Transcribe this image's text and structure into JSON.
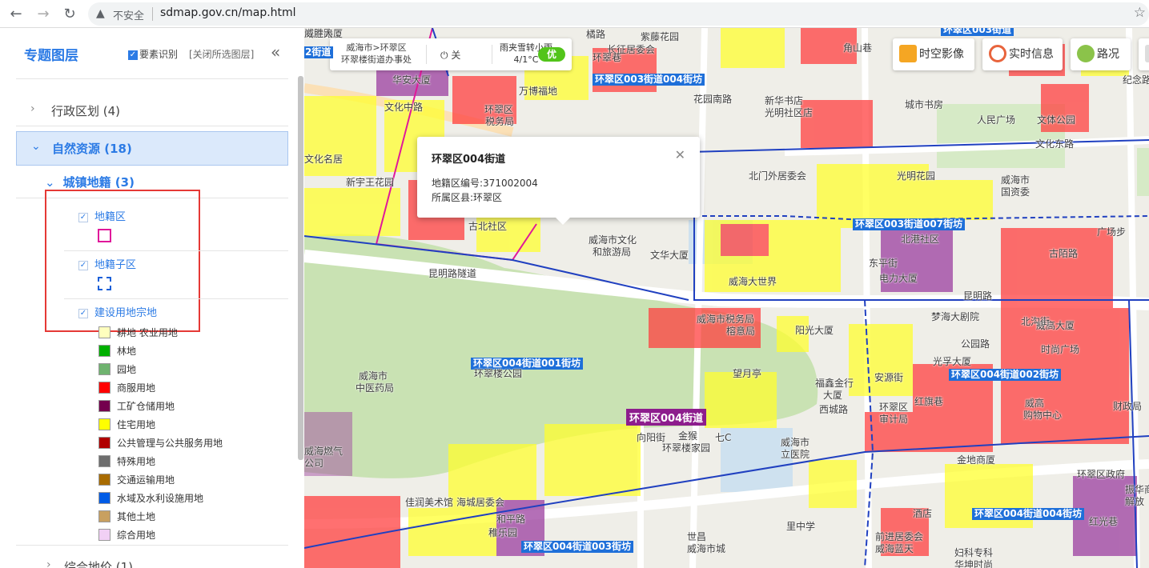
{
  "browser": {
    "security_label": "不安全",
    "url": "sdmap.gov.cn/map.html"
  },
  "panel": {
    "title": "专题图层",
    "feature_toggle": "要素识别",
    "close_selected": "[关闭所选图层]",
    "categories": [
      {
        "label": "行政区划 (4)"
      },
      {
        "label": "自然资源 (18)"
      },
      {
        "label": "综合地价 (1)"
      }
    ],
    "subcategory": "城镇地籍 (3)",
    "layers": [
      {
        "label": "地籍区"
      },
      {
        "label": "地籍子区"
      },
      {
        "label": "建设用地宗地"
      }
    ],
    "legend": [
      {
        "label": "耕地 农业用地",
        "color": "#ffffbe"
      },
      {
        "label": "林地",
        "color": "#00b000"
      },
      {
        "label": "园地",
        "color": "#6fb36f"
      },
      {
        "label": "商服用地",
        "color": "#ff0000"
      },
      {
        "label": "工矿仓储用地",
        "color": "#74004e"
      },
      {
        "label": "住宅用地",
        "color": "#ffff00"
      },
      {
        "label": "公共管理与公共服务用地",
        "color": "#b00000"
      },
      {
        "label": "特殊用地",
        "color": "#6e6e6e"
      },
      {
        "label": "交通运输用地",
        "color": "#a86b00"
      },
      {
        "label": "水域及水利设施用地",
        "color": "#005ce6"
      },
      {
        "label": "其他土地",
        "color": "#c8a060"
      },
      {
        "label": "综合用地",
        "color": "#f1d0f5"
      }
    ]
  },
  "map": {
    "info_bar": {
      "location_line1": "威海市>环翠区",
      "location_line2": "环翠楼街道办事处",
      "power_label": "关",
      "weather_line1": "雨夹雪转小雨",
      "weather_line2": "4/1°C",
      "aqi": "优"
    },
    "tools": [
      {
        "label": "时空影像",
        "icon": "layers-icon"
      },
      {
        "label": "实时信息",
        "icon": "clock-icon"
      },
      {
        "label": "路况",
        "icon": "traffic-icon"
      }
    ],
    "popup": {
      "title": "环翠区004街道",
      "code_label": "地籍区编号:371002004",
      "county_label": "所属区县:环翠区"
    },
    "street_tags": [
      "环翠区003街道004街坊",
      "环翠区003街道007街坊",
      "环翠区004街道001街坊",
      "环翠区004街道002街坊",
      "环翠区004街道003街坊",
      "环翠区004街道004街坊",
      "环翠区003街道",
      "2街道"
    ],
    "district_tag": "环翠区004街道",
    "labels": [
      "橘路",
      "紫藤花园",
      "长征居委会",
      "角山巷",
      "华安大厦",
      "万博福地",
      "文化中路",
      "环翠区",
      "税务局",
      "花园南路",
      "新华书店",
      "光明社区店",
      "城市书房",
      "人民广场",
      "文体公园",
      "纪念路",
      "文化东路",
      "文化名居",
      "新宇王花园",
      "北门外居委会",
      "光明花园",
      "威海市",
      "国资委",
      "古北社区",
      "威海市文化",
      "和旅游局",
      "文华大厦",
      "北港社区",
      "东平街",
      "电力大厦",
      "威海大世界",
      "昆明路隧道",
      "昆明路",
      "威海市税务局",
      "榕意局",
      "阳光大厦",
      "梦海大剧院",
      "光孚大厦",
      "公园路",
      "威高大厦",
      "时尚广场",
      "威海市",
      "中医药局",
      "环翠楼公园",
      "望月亭",
      "福鑫金行",
      "大厦",
      "安源街",
      "环翠区",
      "审计局",
      "威高",
      "购物中心",
      "财政局",
      "金猴",
      "环翠楼家园",
      "威海市",
      "立医院",
      "金地商厦",
      "环翠区政府",
      "威海燃气",
      "公司",
      "海城居委会",
      "佳润美术馆",
      "和平路",
      "稚乐园",
      "世昌",
      "威海市城",
      "里中学",
      "前进居委会",
      "威海蓝天",
      "妇科专科",
      "华坤时尚",
      "酒店",
      "红光巷",
      "振华商厦",
      "解放",
      "七C",
      "西城路",
      "红旗巷",
      "向阳街",
      "环翠巷",
      "北沟街",
      "古陌路",
      "广场步",
      "海港路",
      "威胜大厦"
    ]
  }
}
